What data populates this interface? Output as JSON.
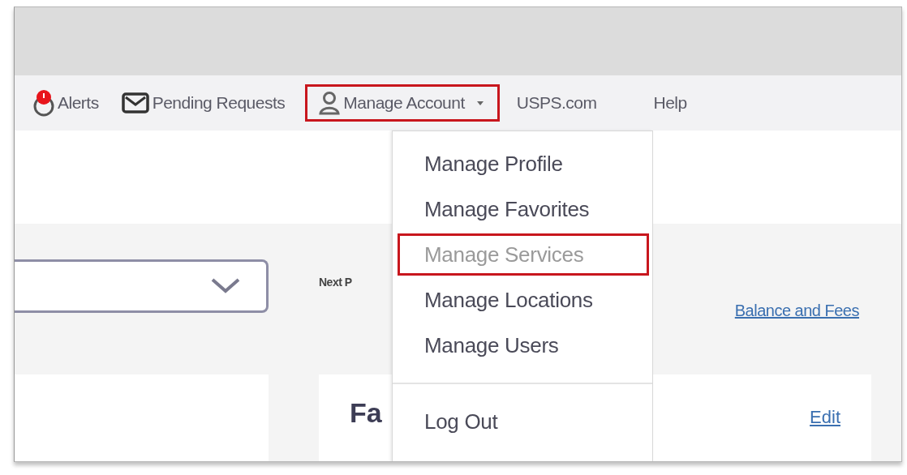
{
  "nav": [
    {
      "kind": "alerts",
      "label": "Alerts",
      "selected": false
    },
    {
      "kind": "mail",
      "label": "Pending Requests",
      "selected": false
    },
    {
      "kind": "account",
      "label": "Manage Account",
      "selected": true
    },
    {
      "kind": "plain",
      "label": "USPS.com",
      "selected": false
    },
    {
      "kind": "plain",
      "label": "Help",
      "selected": false
    }
  ],
  "menu": {
    "items": [
      {
        "label": "Manage Profile",
        "selected": false
      },
      {
        "label": "Manage Favorites",
        "selected": false
      },
      {
        "label": "Manage Services",
        "selected": true
      },
      {
        "label": "Manage Locations",
        "selected": false
      },
      {
        "label": "Manage Users",
        "selected": false
      }
    ],
    "footer": "Log Out"
  },
  "next_label": "Next P",
  "balance_link": "Balance and Fees",
  "card": {
    "title": "Fa",
    "edit": "Edit"
  }
}
